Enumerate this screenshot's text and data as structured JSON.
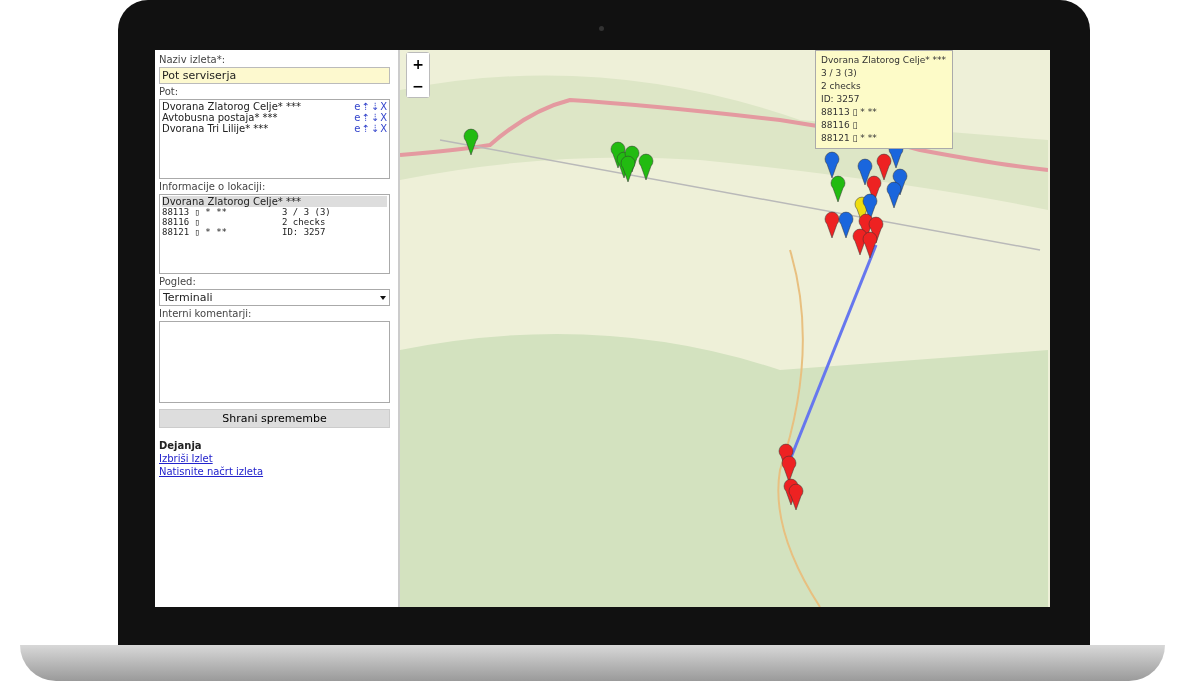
{
  "form": {
    "trip_name_label": "Naziv izleta*:",
    "trip_name_value": "Pot serviserja",
    "route_label": "Pot:",
    "route": [
      {
        "name": "Dvorana Zlatorog Celje* ***",
        "actions": [
          "e",
          "⇡",
          "⇣",
          "X"
        ]
      },
      {
        "name": "Avtobusna postaja* ***",
        "actions": [
          "e",
          "⇡",
          "⇣",
          "X"
        ]
      },
      {
        "name": "Dvorana Tri Lilije* ***",
        "actions": [
          "e",
          "⇡",
          "⇣",
          "X"
        ]
      }
    ],
    "info_label": "Informacije o lokaciji:",
    "info": {
      "title": "Dvorana Zlatorog Celje* ***",
      "rows": [
        {
          "left": "88113 ▯ * **",
          "right": "3 / 3 (3)"
        },
        {
          "left": "88116 ▯",
          "right": "2 checks"
        },
        {
          "left": "88121 ▯ * **",
          "right": "ID: 3257"
        }
      ]
    },
    "view_label": "Pogled:",
    "view_value": "Terminali",
    "comments_label": "Interni komentarji:",
    "save_button": "Shrani spremembe",
    "actions_title": "Dejanja",
    "links": [
      "Izbriši Izlet",
      "Natisnite načrt izleta"
    ]
  },
  "map": {
    "zoom_in": "+",
    "zoom_out": "−",
    "tooltip": [
      "Dvorana Zlatorog Celje* ***",
      "3 / 3 (3)",
      "2 checks",
      "ID: 3257",
      "88113 ▯ * **",
      "88116 ▯",
      "88121 ▯ * **"
    ]
  }
}
